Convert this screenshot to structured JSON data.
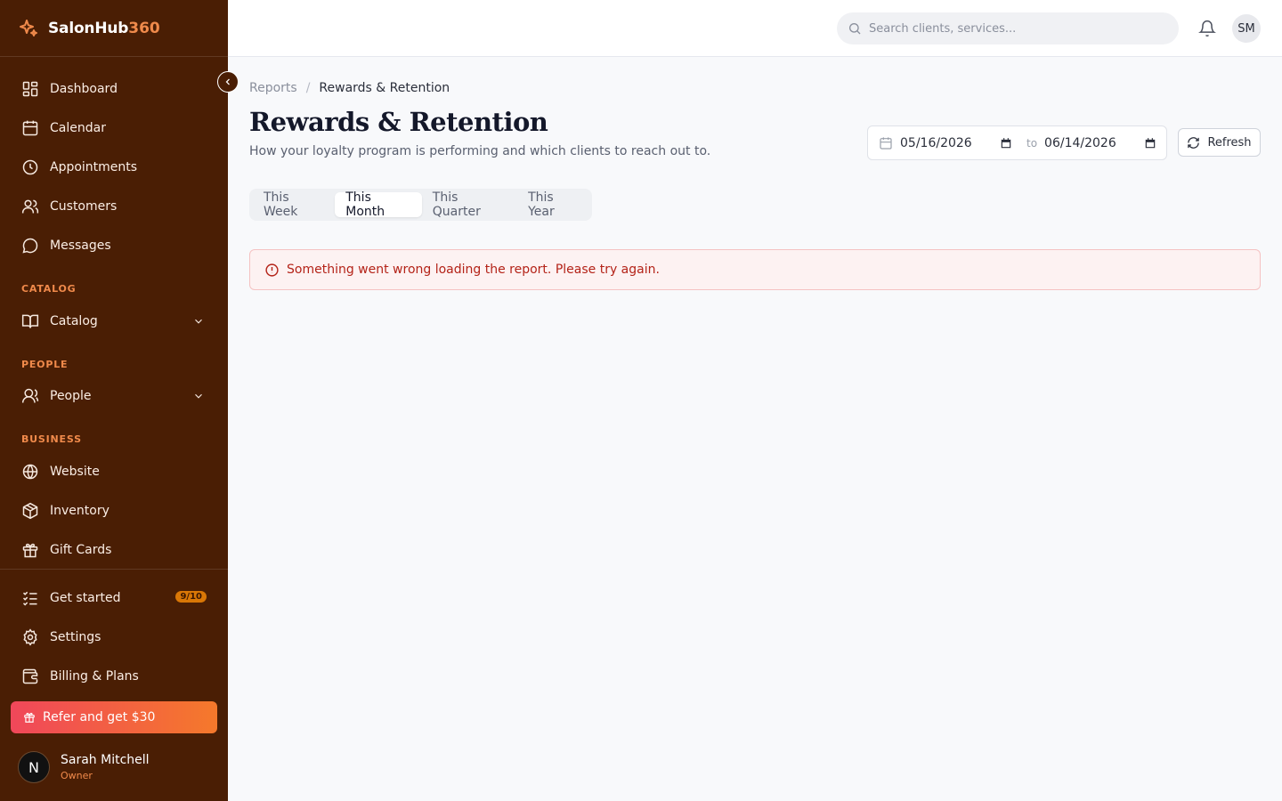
{
  "brand": {
    "name": "SalonHub",
    "accent": "360"
  },
  "sidebar": {
    "primary": [
      {
        "label": "Dashboard",
        "icon": "dashboard-icon"
      },
      {
        "label": "Calendar",
        "icon": "calendar-icon"
      },
      {
        "label": "Appointments",
        "icon": "clock-icon"
      },
      {
        "label": "Customers",
        "icon": "users-icon"
      },
      {
        "label": "Messages",
        "icon": "message-icon"
      }
    ],
    "sections": [
      {
        "label": "CATALOG",
        "item": "Catalog"
      },
      {
        "label": "PEOPLE",
        "item": "People"
      },
      {
        "label": "BUSINESS",
        "items": [
          "Website",
          "Inventory",
          "Gift Cards"
        ]
      }
    ],
    "footer": [
      {
        "label": "Get started",
        "badge": "9/10"
      },
      {
        "label": "Settings"
      },
      {
        "label": "Billing & Plans"
      }
    ],
    "refer_label": "Refer and get $30",
    "user": {
      "initial": "N",
      "name": "Sarah Mitchell",
      "role": "Owner"
    }
  },
  "topbar": {
    "search_placeholder": "Search clients, services...",
    "avatar_initials": "SM"
  },
  "breadcrumb": {
    "parent": "Reports",
    "separator": "/",
    "current": "Rewards & Retention"
  },
  "page": {
    "title": "Rewards & Retention",
    "subtitle": "How your loyalty program is performing and which clients to reach out to."
  },
  "date_range": {
    "from": "05/16/2026",
    "to_label": "to",
    "to": "06/14/2026"
  },
  "refresh_label": "Refresh",
  "tabs": [
    {
      "label": "This Week",
      "active": false
    },
    {
      "label": "This Month",
      "active": true
    },
    {
      "label": "This Quarter",
      "active": false
    },
    {
      "label": "This Year",
      "active": false
    }
  ],
  "error_message": "Something went wrong loading the report. Please try again.",
  "colors": {
    "sidebar_bg": "#4a1e04",
    "accent": "#f08a4b",
    "error_text": "#b42318",
    "error_bg": "#fdf2f2"
  }
}
